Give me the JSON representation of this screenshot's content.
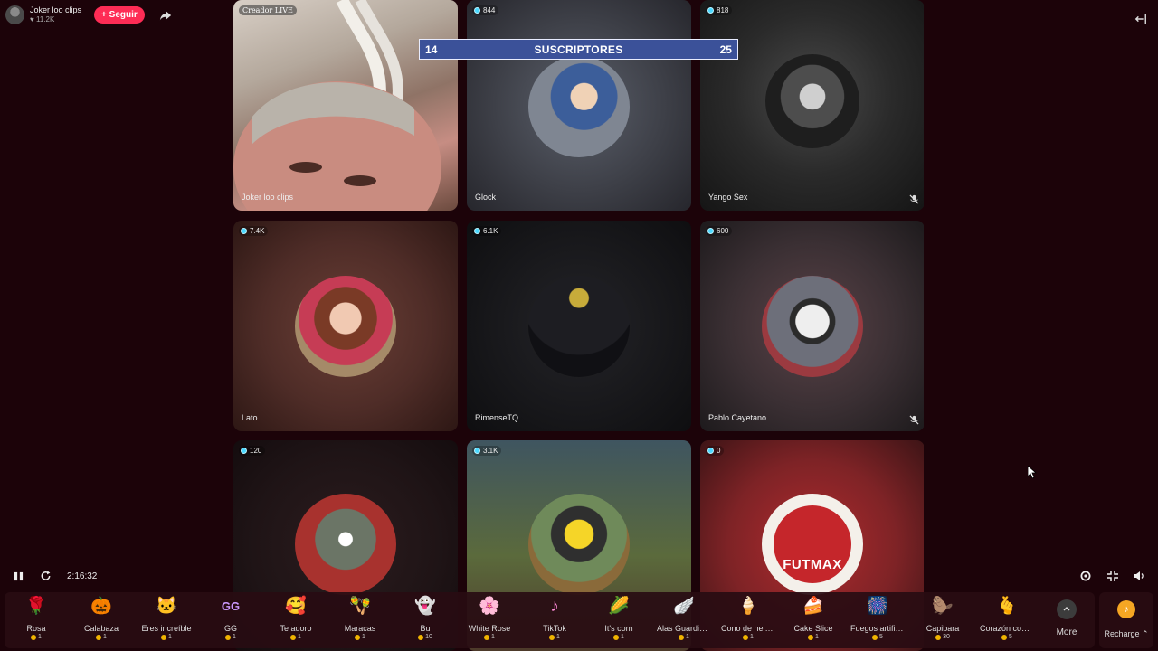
{
  "host": {
    "name": "Joker loo clips",
    "likes": "11.2K",
    "follow_label": "+ Seguir"
  },
  "score": {
    "left": "14",
    "label": "SUSCRIPTORES",
    "right": "25"
  },
  "tiles": [
    {
      "tag": "Creador LIVE",
      "name": "Joker loo clips",
      "viewers": ""
    },
    {
      "tag": "",
      "name": "Glock",
      "viewers": "844"
    },
    {
      "tag": "",
      "name": "Yango Sex",
      "viewers": "818"
    },
    {
      "tag": "",
      "name": "Lato",
      "viewers": "7.4K"
    },
    {
      "tag": "",
      "name": "RimenseTQ",
      "viewers": "6.1K"
    },
    {
      "tag": "",
      "name": "Pablo Cayetano",
      "viewers": "600"
    },
    {
      "tag": "",
      "name": "",
      "viewers": "120"
    },
    {
      "tag": "",
      "name": "",
      "viewers": "3.1K"
    },
    {
      "tag": "",
      "name": "",
      "viewers": "0"
    }
  ],
  "futmax_text": "FUTMAX",
  "timer": "2:16:32",
  "gifts": [
    {
      "name": "Rosa",
      "price": "1",
      "icon": "rose-icon",
      "glyph": "🌹"
    },
    {
      "name": "Calabaza",
      "price": "1",
      "icon": "pumpkin-icon",
      "glyph": "🎃"
    },
    {
      "name": "Eres increíble",
      "price": "1",
      "icon": "cat-icon",
      "glyph": "🐱"
    },
    {
      "name": "GG",
      "price": "1",
      "icon": "gg-icon",
      "glyph": "GG"
    },
    {
      "name": "Te adoro",
      "price": "1",
      "icon": "heart-face-icon",
      "glyph": "🥰"
    },
    {
      "name": "Maracas",
      "price": "1",
      "icon": "maracas-icon",
      "glyph": "🪇"
    },
    {
      "name": "Bu",
      "price": "10",
      "icon": "ghost-icon",
      "glyph": "👻"
    },
    {
      "name": "White Rose",
      "price": "1",
      "icon": "white-rose-icon",
      "glyph": "🌸"
    },
    {
      "name": "TikTok",
      "price": "1",
      "icon": "tiktok-icon",
      "glyph": "♪"
    },
    {
      "name": "It's corn",
      "price": "1",
      "icon": "corn-icon",
      "glyph": "🌽"
    },
    {
      "name": "Alas Guardian...",
      "price": "1",
      "icon": "wings-icon",
      "glyph": "🪽"
    },
    {
      "name": "Cono de helado",
      "price": "1",
      "icon": "ice-cream-icon",
      "glyph": "🍦"
    },
    {
      "name": "Cake Slice",
      "price": "1",
      "icon": "cake-icon",
      "glyph": "🍰"
    },
    {
      "name": "Fuegos artifici...",
      "price": "5",
      "icon": "fireworks-icon",
      "glyph": "🎆"
    },
    {
      "name": "Capibara",
      "price": "30",
      "icon": "capybara-icon",
      "glyph": "🦫"
    },
    {
      "name": "Corazón con l...",
      "price": "5",
      "icon": "finger-heart-icon",
      "glyph": "🫰"
    }
  ],
  "more_label": "More",
  "recharge_label": "Recharge ⌃",
  "colors": {
    "background": "#1c0309",
    "follow": "#fe2c55",
    "score_bar": "#3b5199",
    "viewer_dot": "#4ad8ff",
    "coin": "#f0b400"
  }
}
